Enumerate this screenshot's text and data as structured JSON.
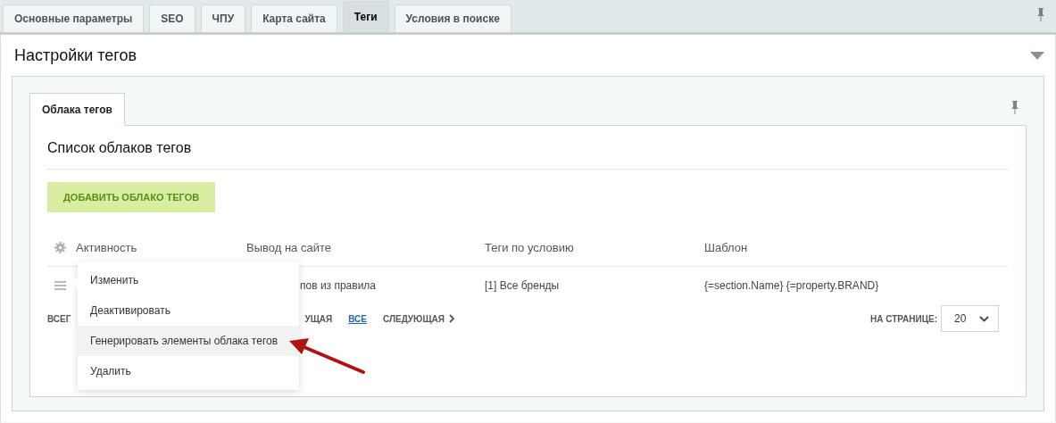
{
  "tabs": [
    {
      "label": "Основные параметры",
      "selected": false
    },
    {
      "label": "SEO",
      "selected": false
    },
    {
      "label": "ЧПУ",
      "selected": false
    },
    {
      "label": "Карта сайта",
      "selected": false
    },
    {
      "label": "Теги",
      "selected": true
    },
    {
      "label": "Условия в поиске",
      "selected": false
    }
  ],
  "panel": {
    "title": "Настройки тегов",
    "expanded": true
  },
  "inner_tabs": [
    {
      "label": "Облака тегов",
      "selected": true
    }
  ],
  "list": {
    "title": "Список облаков тегов",
    "add_button": "ДОБАВИТЬ ОБЛАКО ТЕГОВ",
    "columns": [
      "Активность",
      "Вывод на сайте",
      "Теги по условию",
      "Шаблон"
    ],
    "rows": [
      {
        "output": "пов из правила",
        "tags": "[1] Все бренды",
        "template": "{=section.Name} {=property.BRAND}"
      }
    ],
    "pager": [
      {
        "label": "ВСЕГ",
        "selected": false
      },
      {
        "label": "УЩАЯ",
        "selected": false
      },
      {
        "label": "ВСЕ",
        "selected": true
      },
      {
        "label": "СЛЕДУЮЩАЯ",
        "selected": false
      }
    ],
    "per_page_label": "НА СТРАНИЦЕ:",
    "per_page": "20"
  },
  "context_menu": [
    {
      "label": "Изменить",
      "selected": false
    },
    {
      "label": "Деактивировать",
      "selected": false
    },
    {
      "label": "Генерировать элементы облака тегов",
      "selected": true
    },
    {
      "label": "Удалить",
      "selected": false
    }
  ]
}
